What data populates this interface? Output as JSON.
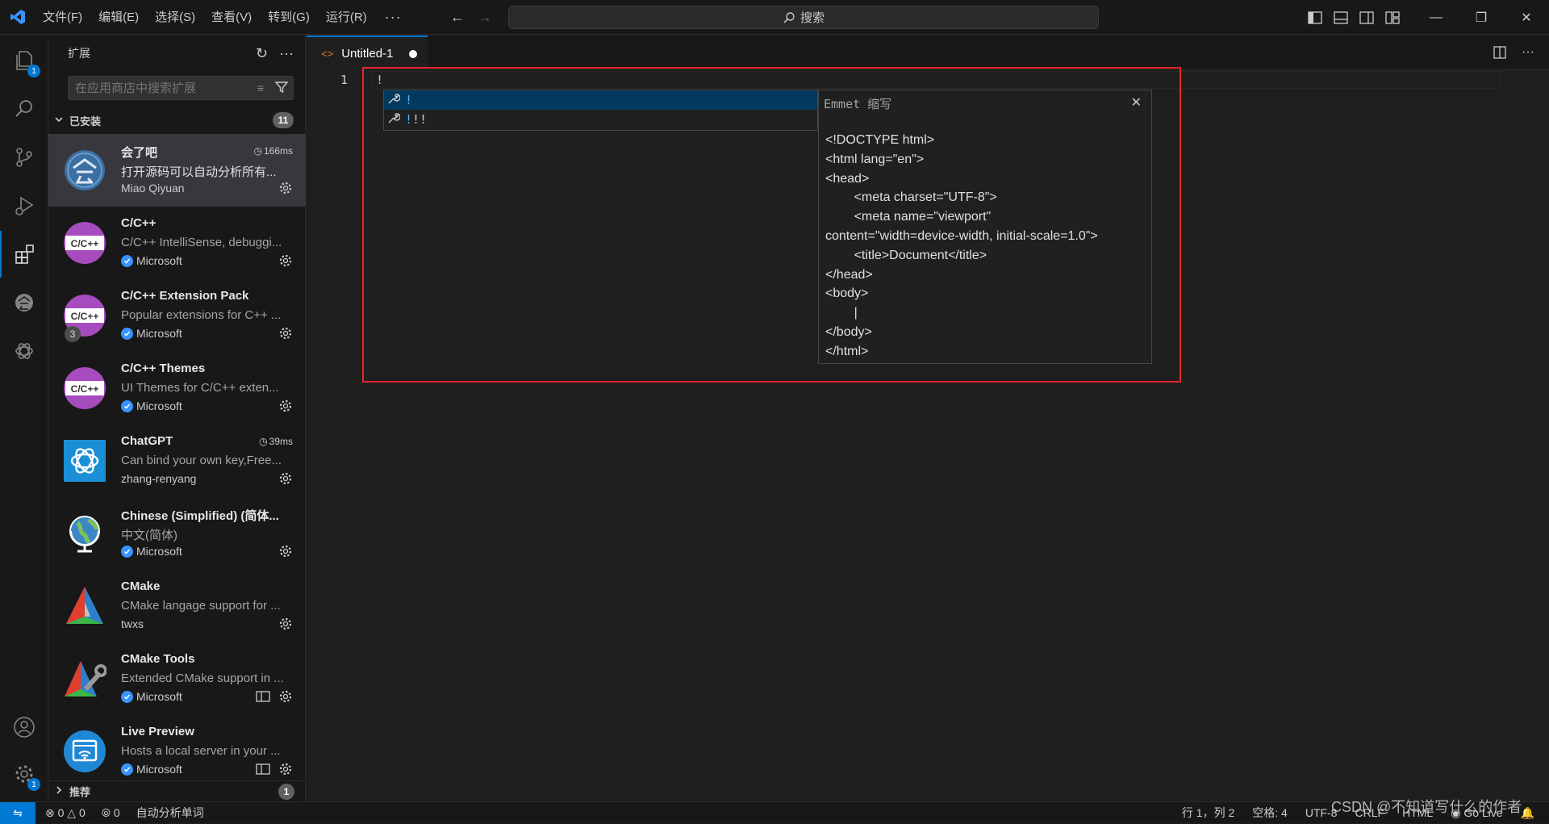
{
  "menu": [
    "文件(F)",
    "编辑(E)",
    "选择(S)",
    "查看(V)",
    "转到(G)",
    "运行(R)",
    "···"
  ],
  "search": {
    "label": "搜索"
  },
  "activity": {
    "explorer_badge": "1",
    "settings_badge": "1"
  },
  "sidebar": {
    "title": "扩展",
    "search_placeholder": "在应用商店中搜索扩展",
    "installed_label": "已安装",
    "installed_count": "11",
    "recommended_label": "推荐",
    "recommended_count": "1",
    "extensions": [
      {
        "name": "会了吧",
        "desc": "打开源码可以自动分析所有...",
        "publisher": "Miao Qiyuan",
        "time": "166ms",
        "icon": "huileba-icon"
      },
      {
        "name": "C/C++",
        "desc": "C/C++ IntelliSense, debuggi...",
        "publisher": "Microsoft",
        "icon": "cpp-icon"
      },
      {
        "name": "C/C++ Extension Pack",
        "desc": "Popular extensions for C++ ...",
        "publisher": "Microsoft",
        "badge": "3",
        "icon": "cpp-icon"
      },
      {
        "name": "C/C++ Themes",
        "desc": "UI Themes for C/C++ exten...",
        "publisher": "Microsoft",
        "icon": "cpp-icon"
      },
      {
        "name": "ChatGPT",
        "desc": "Can bind your own key,Free...",
        "publisher": "zhang-renyang",
        "time": "39ms",
        "icon": "chatgpt-icon"
      },
      {
        "name": "Chinese (Simplified) (简体...",
        "desc": "中文(简体)",
        "publisher": "Microsoft",
        "icon": "globe-icon"
      },
      {
        "name": "CMake",
        "desc": "CMake langage support for ...",
        "publisher": "twxs",
        "icon": "cmake-icon"
      },
      {
        "name": "CMake Tools",
        "desc": "Extended CMake support in ...",
        "publisher": "Microsoft",
        "icon": "cmake-tools-icon"
      },
      {
        "name": "Live Preview",
        "desc": "Hosts a local server in your ...",
        "publisher": "Microsoft",
        "icon": "live-preview-icon"
      }
    ]
  },
  "editor": {
    "tab_title": "Untitled-1",
    "line_number": "1",
    "code": "!",
    "suggestions": [
      {
        "match": "!",
        "rest": ""
      },
      {
        "match": "!",
        "rest": "!!"
      }
    ],
    "details_title": "Emmet 缩写",
    "details_code": "<!DOCTYPE html>\n<html lang=\"en\">\n<head>\n        <meta charset=\"UTF-8\">\n        <meta name=\"viewport\"\ncontent=\"width=device-width, initial-scale=1.0\">\n        <title>Document</title>\n</head>\n<body>\n        |\n</body>\n</html>"
  },
  "status": {
    "errors": "0",
    "warnings": "0",
    "ports": "0",
    "analyze": "自动分析单词",
    "position": "行 1，列 2",
    "spaces": "空格: 4",
    "encoding": "UTF-8",
    "eol": "CRLF",
    "language": "HTML",
    "golive": "Go Live"
  },
  "watermark": "CSDN @不知道写什么的作者",
  "colors": {
    "accent": "#0078d4",
    "highlight_box": "#e5252a",
    "match": "#4fb2ff"
  }
}
